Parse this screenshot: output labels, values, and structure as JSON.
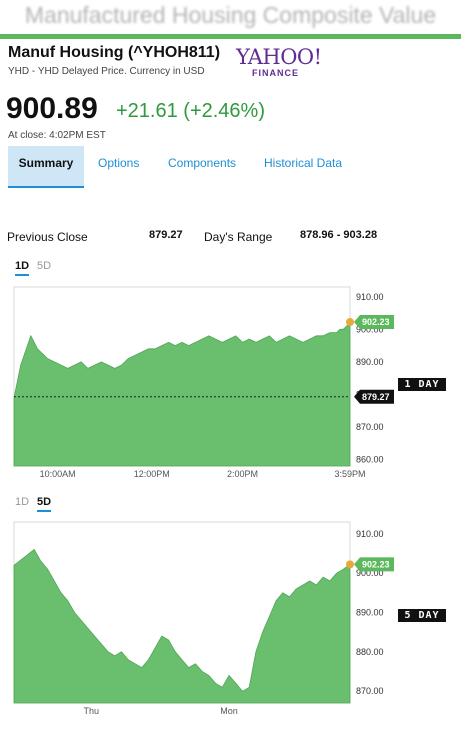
{
  "banner": "Manufactured Housing Composite Value",
  "quote": {
    "title": "Manuf Housing (^YHOH811)",
    "subtitle": "YHD - YHD Delayed Price. Currency in USD",
    "price": "900.89",
    "change": "+21.61 (+2.46%)",
    "close_time": "At close: 4:02PM EST"
  },
  "logo": {
    "word": "YAHOO!",
    "sub": "FINANCE"
  },
  "tabs": [
    "Summary",
    "Options",
    "Components",
    "Historical Data"
  ],
  "stats": {
    "prev_close_label": "Previous Close",
    "prev_close_value": "879.27",
    "days_range_label": "Day's Range",
    "days_range_value": "878.96 - 903.28"
  },
  "colors": {
    "accent": "#1e8fd6",
    "area": "#6abf6e",
    "up": "#2e9a3e",
    "marker": "#e8a93a",
    "badge": "#5cb85c"
  },
  "charts": {
    "one_day": {
      "tabs": [
        "1D",
        "5D"
      ],
      "selected": "1D",
      "side_label": "1 DAY",
      "last_price": "902.23",
      "prev_close": "879.27"
    },
    "five_day": {
      "tabs": [
        "1D",
        "5D"
      ],
      "selected": "5D",
      "side_label": "5 DAY",
      "last_price": "902.23"
    }
  },
  "chart_data": [
    {
      "type": "area",
      "title": "",
      "xlabel": "",
      "ylabel": "",
      "ylim": [
        858,
        913
      ],
      "y_ticks": [
        "910.00",
        "900.00",
        "890.00",
        "880.00",
        "870.00",
        "860.00"
      ],
      "y_tick_values": [
        910,
        900,
        890,
        880,
        870,
        860
      ],
      "x_ticks": [
        "10:00AM",
        "12:00PM",
        "2:00PM",
        "3:59PM"
      ],
      "x_tick_values": [
        0.13,
        0.41,
        0.68,
        1.0
      ],
      "reference_line": 879.27,
      "x": [
        0,
        0.01,
        0.02,
        0.03,
        0.04,
        0.05,
        0.06,
        0.07,
        0.08,
        0.09,
        0.1,
        0.12,
        0.14,
        0.16,
        0.18,
        0.2,
        0.22,
        0.24,
        0.26,
        0.28,
        0.3,
        0.32,
        0.34,
        0.36,
        0.38,
        0.4,
        0.42,
        0.44,
        0.46,
        0.48,
        0.5,
        0.52,
        0.54,
        0.56,
        0.58,
        0.6,
        0.62,
        0.64,
        0.66,
        0.68,
        0.7,
        0.72,
        0.74,
        0.76,
        0.78,
        0.8,
        0.82,
        0.84,
        0.86,
        0.88,
        0.9,
        0.92,
        0.94,
        0.96,
        0.97,
        0.98,
        0.99,
        1.0
      ],
      "y": [
        879,
        884,
        889,
        892,
        895,
        898,
        896,
        894,
        893,
        892,
        891,
        890,
        889,
        888,
        889,
        890,
        888,
        889,
        890,
        889,
        888,
        889,
        891,
        892,
        893,
        894,
        894,
        895,
        896,
        895,
        896,
        895,
        896,
        897,
        898,
        897,
        896,
        897,
        898,
        896,
        897,
        896,
        897,
        898,
        896,
        897,
        898,
        897,
        896,
        897,
        898,
        898,
        899,
        899,
        900,
        900,
        901,
        902.23
      ]
    },
    {
      "type": "area",
      "title": "",
      "xlabel": "",
      "ylabel": "",
      "ylim": [
        867,
        913
      ],
      "y_ticks": [
        "910.00",
        "900.00",
        "890.00",
        "880.00",
        "870.00"
      ],
      "y_tick_values": [
        910,
        900,
        890,
        880,
        870
      ],
      "x_ticks": [
        "Thu",
        "Mon"
      ],
      "x_tick_values": [
        0.23,
        0.64
      ],
      "x": [
        0,
        0.03,
        0.06,
        0.08,
        0.1,
        0.12,
        0.14,
        0.16,
        0.18,
        0.2,
        0.22,
        0.24,
        0.26,
        0.28,
        0.3,
        0.32,
        0.34,
        0.36,
        0.38,
        0.4,
        0.42,
        0.44,
        0.46,
        0.48,
        0.5,
        0.52,
        0.54,
        0.56,
        0.58,
        0.6,
        0.62,
        0.64,
        0.66,
        0.68,
        0.7,
        0.72,
        0.74,
        0.76,
        0.78,
        0.8,
        0.82,
        0.84,
        0.86,
        0.88,
        0.9,
        0.92,
        0.94,
        0.96,
        0.98,
        1.0
      ],
      "y": [
        902,
        904,
        906,
        903,
        901,
        898,
        895,
        893,
        890,
        888,
        886,
        884,
        882,
        880,
        879,
        880,
        878,
        877,
        876,
        878,
        881,
        884,
        883,
        880,
        878,
        876,
        877,
        875,
        874,
        872,
        871,
        874,
        872,
        870,
        871,
        880,
        885,
        889,
        893,
        895,
        894,
        896,
        897,
        898,
        897,
        899,
        898,
        900,
        901,
        902.23
      ]
    }
  ]
}
